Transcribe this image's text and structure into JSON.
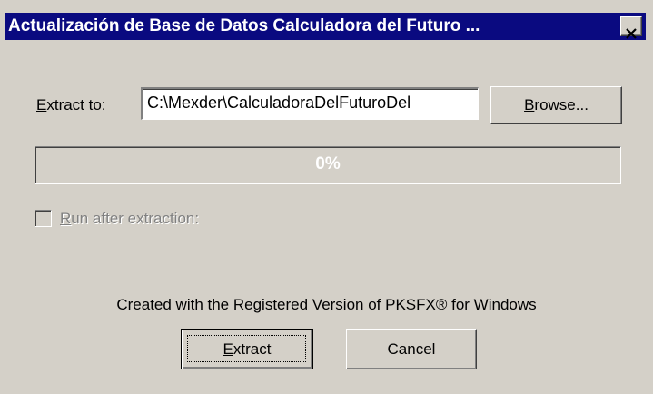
{
  "window": {
    "title": "Actualización de Base de Datos Calculadora del Futuro ..."
  },
  "extract": {
    "label_underlined": "E",
    "label_rest": "xtract to:",
    "path_value": "C:\\Mexder\\CalculadoraDelFuturoDel",
    "browse_underlined": "B",
    "browse_rest": "rowse..."
  },
  "progress": {
    "text": "0%",
    "fraction": 0
  },
  "run_after": {
    "underlined": "R",
    "rest": "un after extraction:",
    "checked": false,
    "enabled": false
  },
  "footer": {
    "credit": "Created with the Registered Version of PKSFX® for Windows"
  },
  "buttons": {
    "extract_underlined": "E",
    "extract_rest": "xtract",
    "cancel": "Cancel"
  },
  "colors": {
    "titlebar": "#0a0a80",
    "face": "#d4d0c8",
    "progress_fill": "#0a0a80"
  },
  "icons": {
    "close": "close-icon"
  }
}
